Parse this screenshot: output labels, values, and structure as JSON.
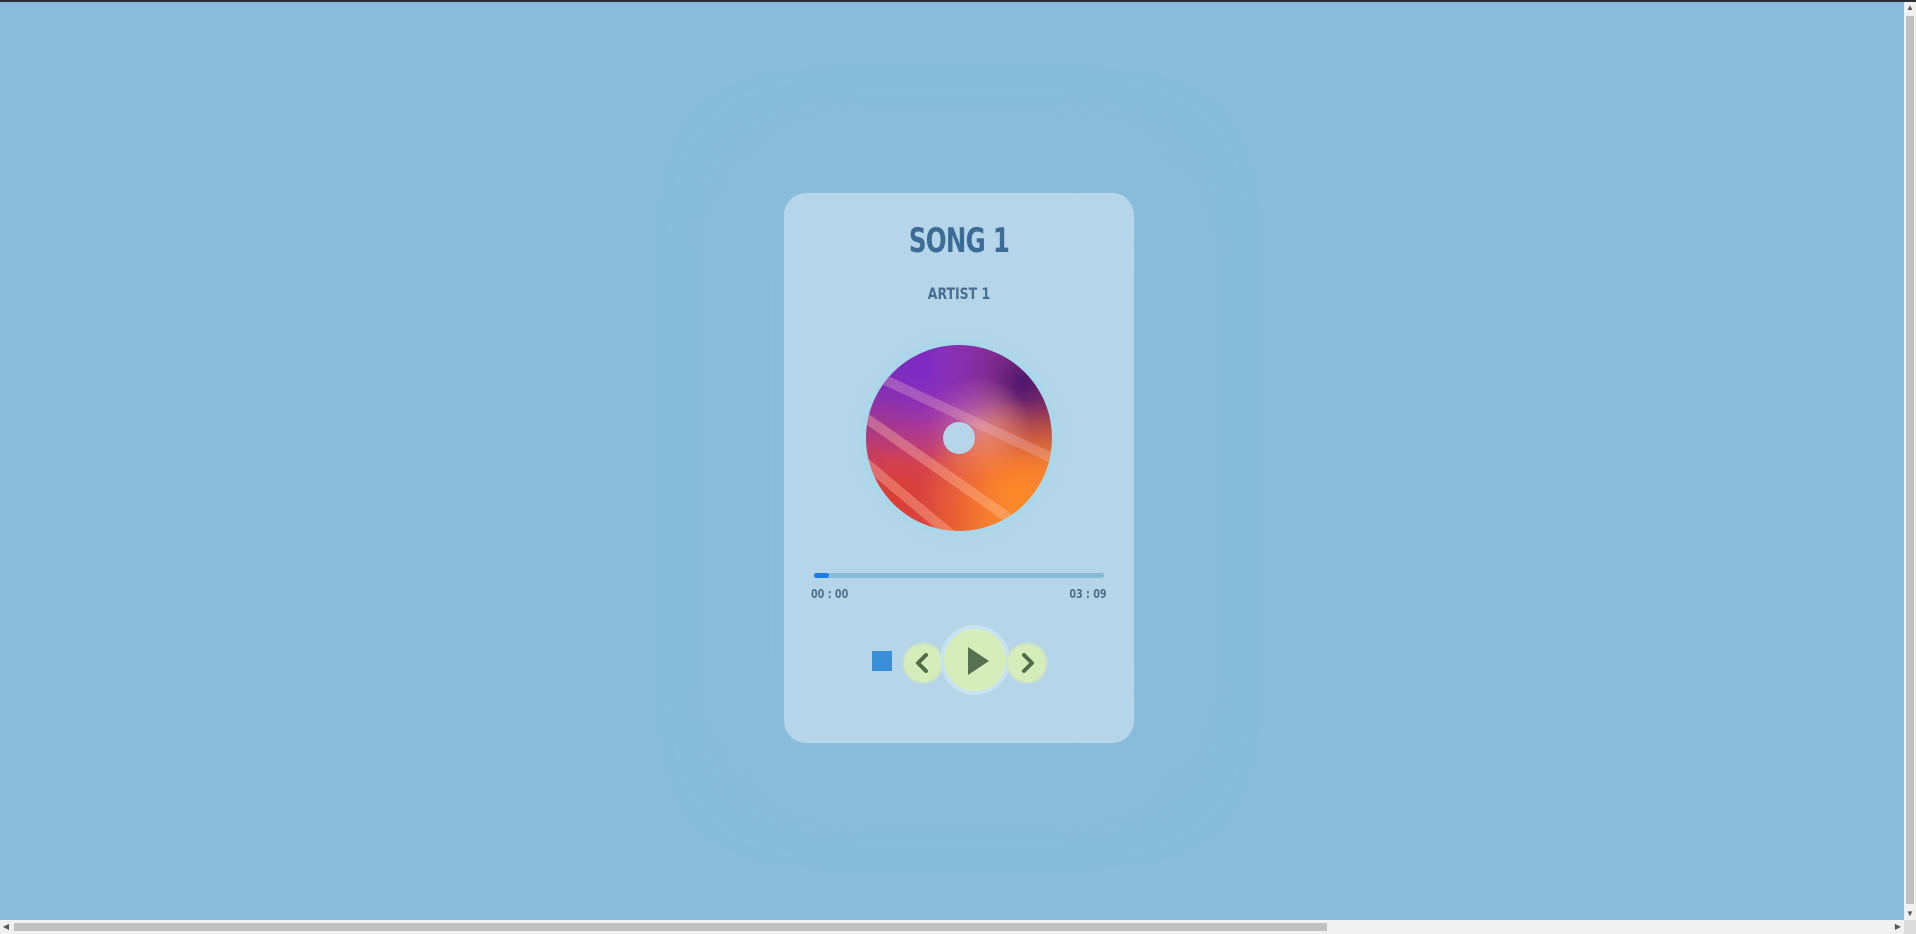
{
  "player": {
    "song_title": "SONG 1",
    "artist": "ARTIST 1",
    "current_time": "00 : 00",
    "total_time": "03 : 09",
    "progress": 0.05
  },
  "icons": {
    "stop": "stop-icon",
    "previous": "chevron-left-icon",
    "play": "play-icon",
    "next": "chevron-right-icon"
  },
  "colors": {
    "background": "#88bcda",
    "card": "#b6d5e8",
    "title": "#3b6b97",
    "progress_fill": "#1a7ce6",
    "button": "#d6ecbb"
  }
}
